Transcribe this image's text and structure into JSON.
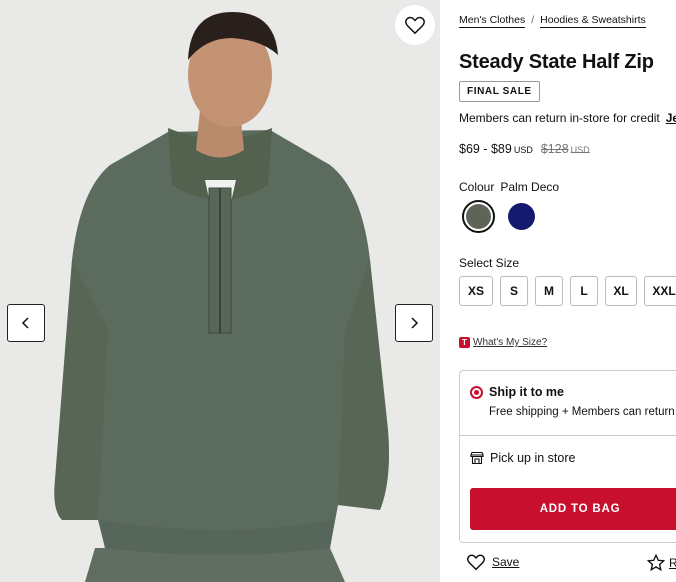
{
  "breadcrumb": {
    "items": [
      "Men's Clothes",
      "Hoodies & Sweatshirts"
    ],
    "separator": "/"
  },
  "product": {
    "title": "Steady State Half Zip",
    "badge": "FINAL SALE",
    "member_note": "Members can return in-store for credit",
    "member_link": "Je",
    "price_range": "$69 - $89",
    "currency": "USD",
    "was_price": "$128"
  },
  "colour": {
    "label": "Colour",
    "selected_name": "Palm Deco",
    "swatches": [
      {
        "name": "Palm Deco",
        "color": "#5f6459",
        "selected": true
      },
      {
        "name": "Navy",
        "color": "#141a6e",
        "selected": false
      }
    ]
  },
  "size": {
    "label": "Select Size",
    "options": [
      "XS",
      "S",
      "M",
      "L",
      "XL",
      "XXL"
    ]
  },
  "fit_link": {
    "icon_letter": "T",
    "text": "What's My Size?"
  },
  "fulfilment": {
    "ship_title": "Ship it to me",
    "ship_sub": "Free shipping + Members can return",
    "pickup_label": "Pick up in store",
    "add_to_bag": "ADD TO BAG"
  },
  "actions": {
    "save_label": "Save",
    "review_label": "R"
  },
  "colors": {
    "accent": "#c8102e",
    "image_bg": "#e9e9e7",
    "sweater": "#5a6a5c"
  }
}
